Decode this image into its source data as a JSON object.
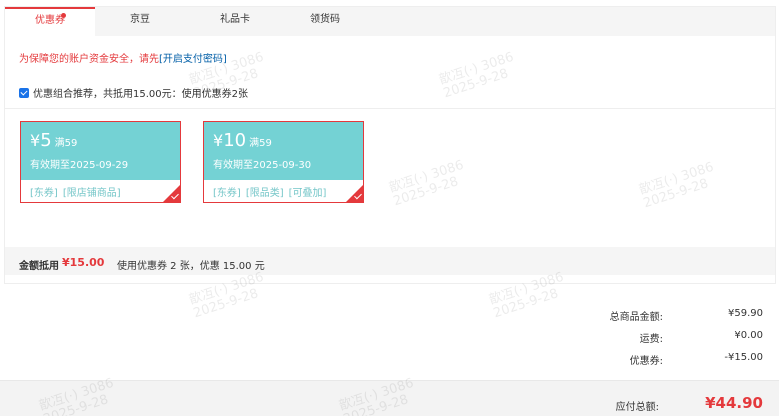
{
  "tabs": [
    {
      "label": "优惠券",
      "active": true,
      "dot": true
    },
    {
      "label": "京豆",
      "active": false
    },
    {
      "label": "礼品卡",
      "active": false
    },
    {
      "label": "领货码",
      "active": false
    }
  ],
  "security_notice": {
    "text": "为保障您的账户资金安全，请先",
    "link": "[开启支付密码]"
  },
  "combo": {
    "checked": true,
    "text": "优惠组合推荐，共抵用15.00元：使用优惠券2张"
  },
  "coupons": [
    {
      "currency": "¥",
      "amount": "5",
      "condition": "满59",
      "validity": "有效期至2025-09-29",
      "tags": [
        "[东券]",
        "[限店铺商品]"
      ],
      "selected": true
    },
    {
      "currency": "¥",
      "amount": "10",
      "condition": "满59",
      "validity": "有效期至2025-09-30",
      "tags": [
        "[东券]",
        "[限品类]",
        "[可叠加]"
      ],
      "selected": true
    }
  ],
  "deduction": {
    "label": "金额抵用",
    "amount": "¥15.00",
    "desc": "使用优惠券 2 张，优惠 15.00 元"
  },
  "totals": [
    {
      "label": "总商品金额:",
      "value": "¥59.90"
    },
    {
      "label": "运费:",
      "value": "¥0.00"
    },
    {
      "label": "优惠券:",
      "value": "-¥15.00"
    }
  ],
  "payable": {
    "label": "应付总额:",
    "value": "¥44.90"
  },
  "watermark": "歆冱(·) 3086\n2025-9-28",
  "colors": {
    "accent": "#e4393c",
    "coupon": "#74d2d4",
    "link": "#005ea7"
  }
}
